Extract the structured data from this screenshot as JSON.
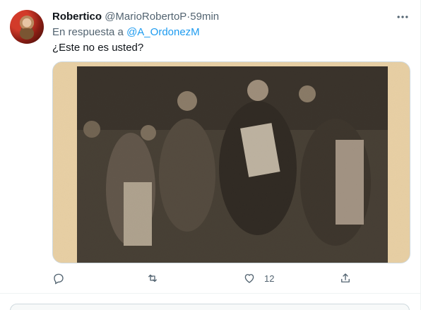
{
  "tweet": {
    "display_name": "Robertico",
    "handle": "@MarioRobertoP",
    "separator": "·",
    "time": "59min",
    "reply_prefix": "En respuesta a",
    "reply_to": "@A_OrdonezM",
    "text": "¿Este no es usted?",
    "more_icon": "more-horizontal-icon"
  },
  "actions": {
    "reply_icon": "reply-icon",
    "retweet_icon": "retweet-icon",
    "like_icon": "heart-icon",
    "like_count": "12",
    "share_icon": "share-icon"
  },
  "colors": {
    "accent": "#1d9bf0",
    "secondary_text": "#536471",
    "photo_frame": "#e8cfa3"
  }
}
